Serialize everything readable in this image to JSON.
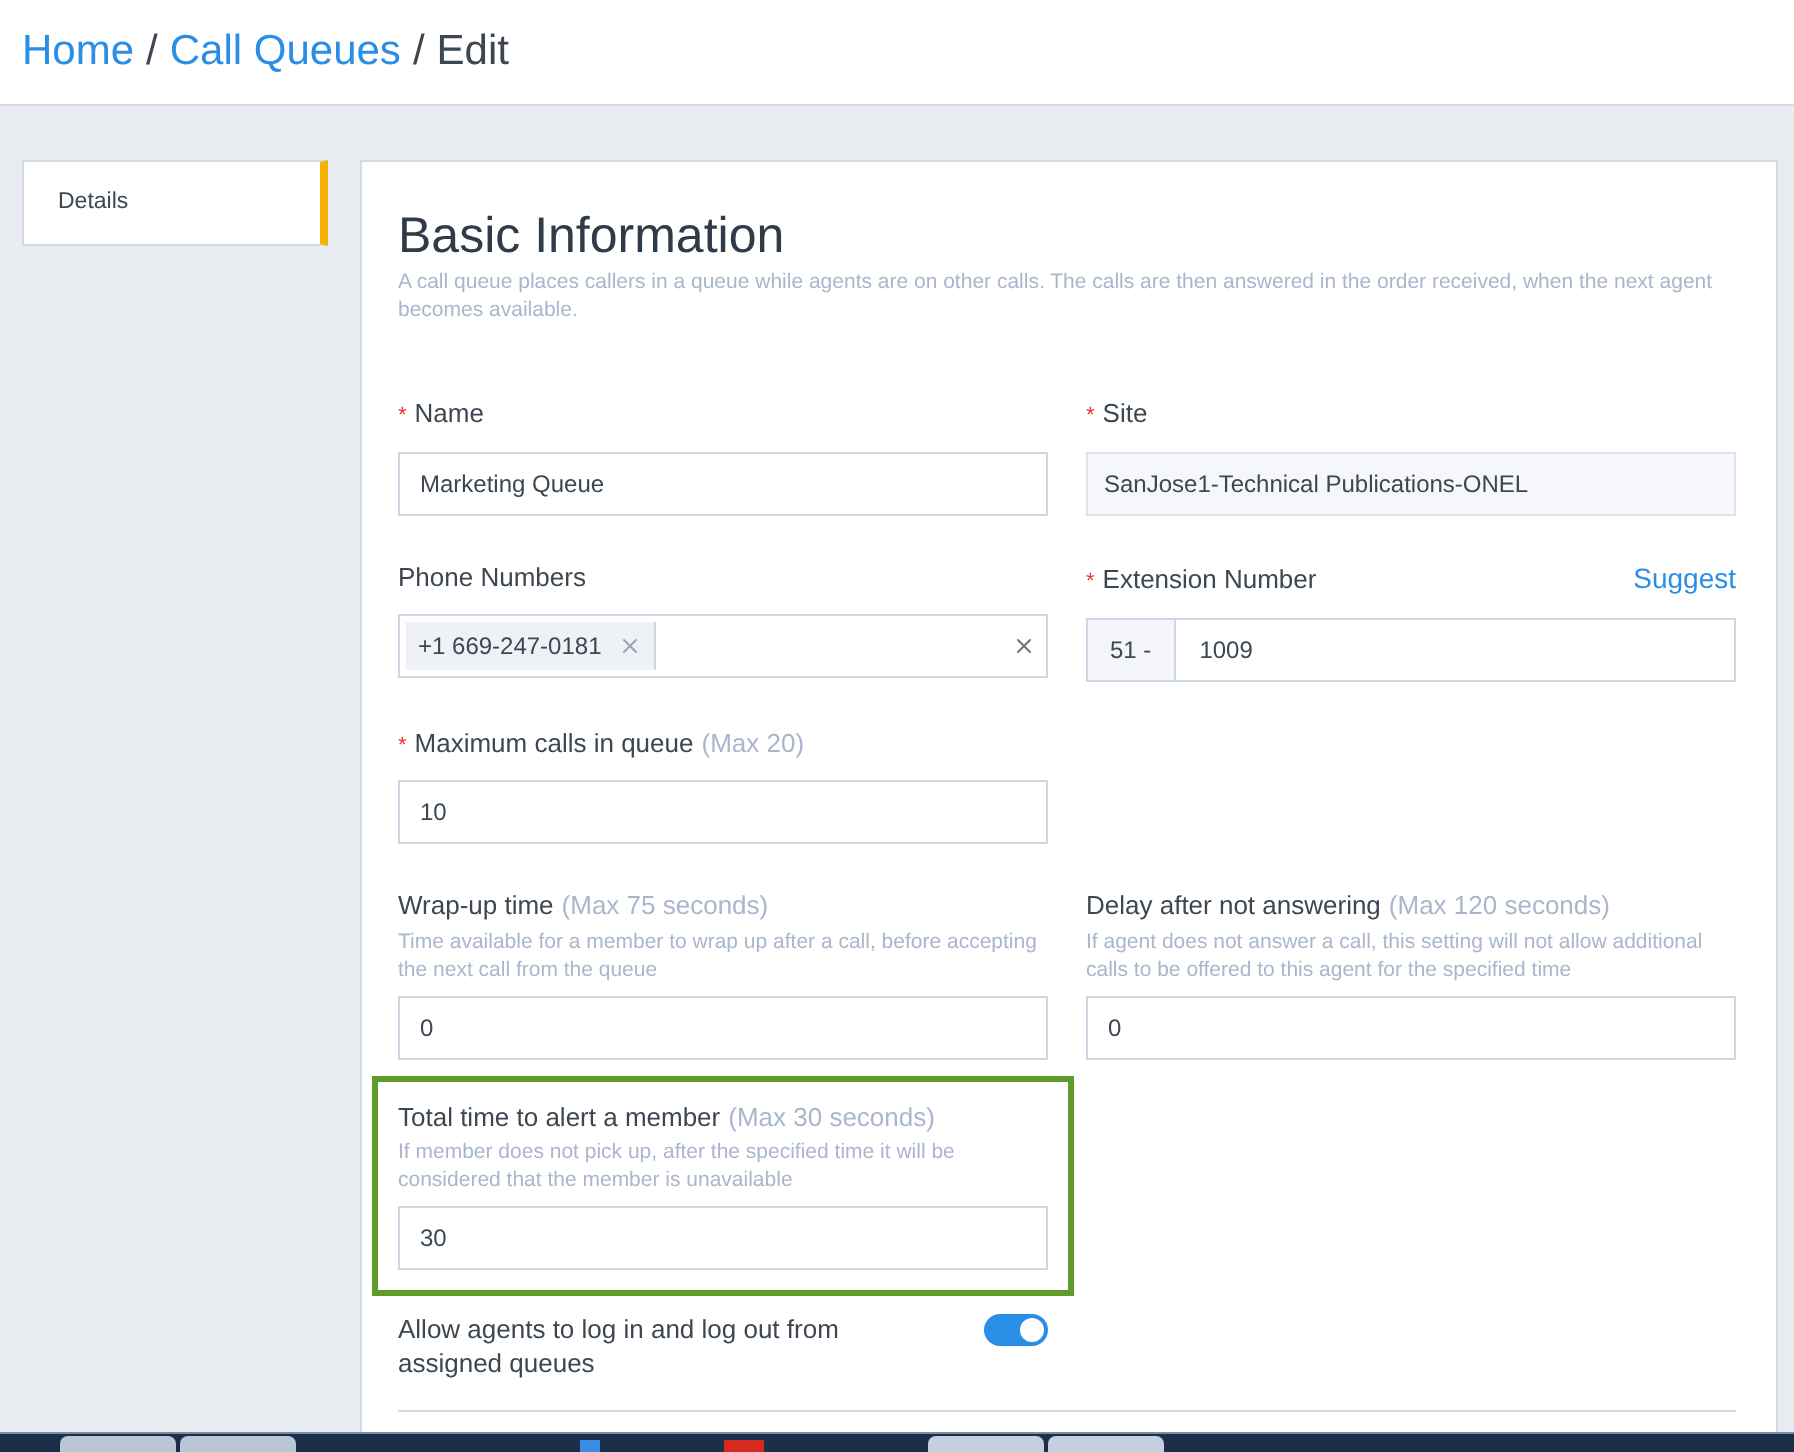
{
  "required_mark": "*",
  "breadcrumb": {
    "separator": "/",
    "items": [
      {
        "label": "Home",
        "link": true
      },
      {
        "label": "Call Queues",
        "link": true
      },
      {
        "label": "Edit",
        "link": false
      }
    ]
  },
  "sidebar": {
    "items": [
      {
        "label": "Details",
        "selected": true
      }
    ]
  },
  "section": {
    "title": "Basic Information",
    "description": "A call queue places callers in a queue while agents are on other calls. The calls are then answered in the order received, when the next agent becomes available."
  },
  "rows": [
    {
      "fields": [
        {
          "kind": "input",
          "required": true,
          "label": "Name",
          "value": "Marketing Queue"
        },
        {
          "kind": "readonly",
          "required": true,
          "label": "Site",
          "value": "SanJose1-Technical Publications-ONEL"
        }
      ]
    },
    {
      "fields": [
        {
          "kind": "tags",
          "required": false,
          "label": "Phone Numbers",
          "tags": [
            "+1 669-247-0181"
          ]
        },
        {
          "kind": "prefixed",
          "required": true,
          "label": "Extension Number",
          "action": "Suggest",
          "prefix": "51 -",
          "value": "1009"
        }
      ]
    },
    {
      "fields": [
        {
          "kind": "input",
          "required": true,
          "label": "Maximum calls in queue",
          "hint": "(Max 20)",
          "value": "10"
        }
      ]
    },
    {
      "fields": [
        {
          "kind": "input",
          "required": false,
          "label": "Wrap-up time",
          "hint": "(Max 75 seconds)",
          "description": "Time available for a member to wrap up after a call, before accepting the next call from the queue",
          "value": "0"
        },
        {
          "kind": "input",
          "required": false,
          "label": "Delay after not answering",
          "hint": "(Max 120 seconds)",
          "description": "If agent does not answer a call, this setting will not allow additional calls to be offered to this agent for the specified time",
          "value": "0"
        }
      ]
    },
    {
      "fields": [
        {
          "kind": "input",
          "required": false,
          "highlighted": true,
          "label": "Total time to alert a member",
          "hint": "(Max 30 seconds)",
          "description": "If member does not pick up, after the specified time it will be considered that the member is unavailable",
          "value": "30"
        }
      ]
    },
    {
      "fields": [
        {
          "kind": "toggle",
          "label": "Allow agents to log in and log out from assigned queues",
          "on": true
        }
      ]
    }
  ]
}
